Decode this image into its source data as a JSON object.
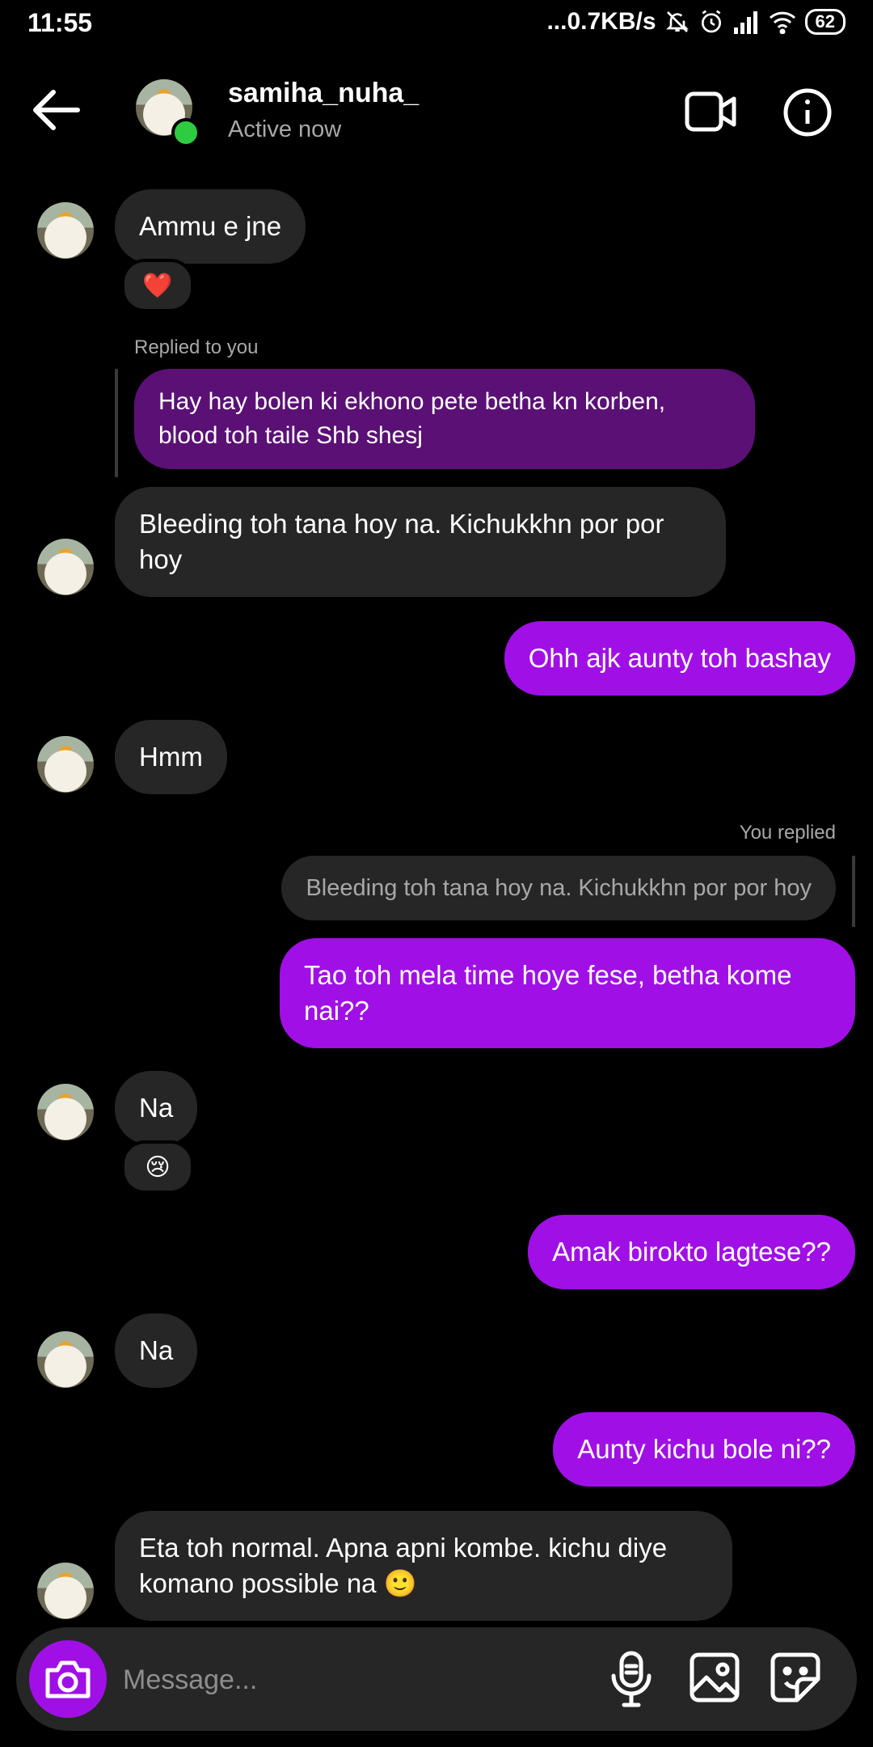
{
  "status_bar": {
    "time": "11:55",
    "network": "...0.7KB/s",
    "battery": "62"
  },
  "header": {
    "username": "samiha_nuha_",
    "status": "Active now"
  },
  "messages": [
    {
      "text": "Ammu e jne",
      "reaction": "❤️"
    },
    {
      "meta": "Replied to you",
      "text": "Hay hay bolen ki ekhono pete betha kn korben, blood toh taile Shb shesj"
    },
    {
      "text": "Bleeding toh tana hoy na. Kichukkhn por por hoy"
    },
    {
      "text": "Ohh ajk aunty toh bashay"
    },
    {
      "text": "Hmm"
    },
    {
      "meta": "You replied",
      "quote": "Bleeding toh tana hoy na. Kichukkhn por por hoy",
      "text": "Tao toh mela time hoye fese, betha kome nai??"
    },
    {
      "text": "Na",
      "reaction": "😢"
    },
    {
      "text": "Amak birokto lagtese??"
    },
    {
      "text": "Na"
    },
    {
      "text": "Aunty kichu bole ni??"
    },
    {
      "text": "Eta toh normal. Apna apni kombe. kichu diye komano possible na 🙂"
    }
  ],
  "composer": {
    "placeholder": "Message..."
  },
  "colors": {
    "sent": "#a010e6",
    "received": "#262626",
    "online": "#2ecc40"
  },
  "icons": [
    "back-arrow-icon",
    "video-call-icon",
    "info-icon",
    "camera-icon",
    "microphone-icon",
    "gallery-icon",
    "sticker-icon"
  ]
}
